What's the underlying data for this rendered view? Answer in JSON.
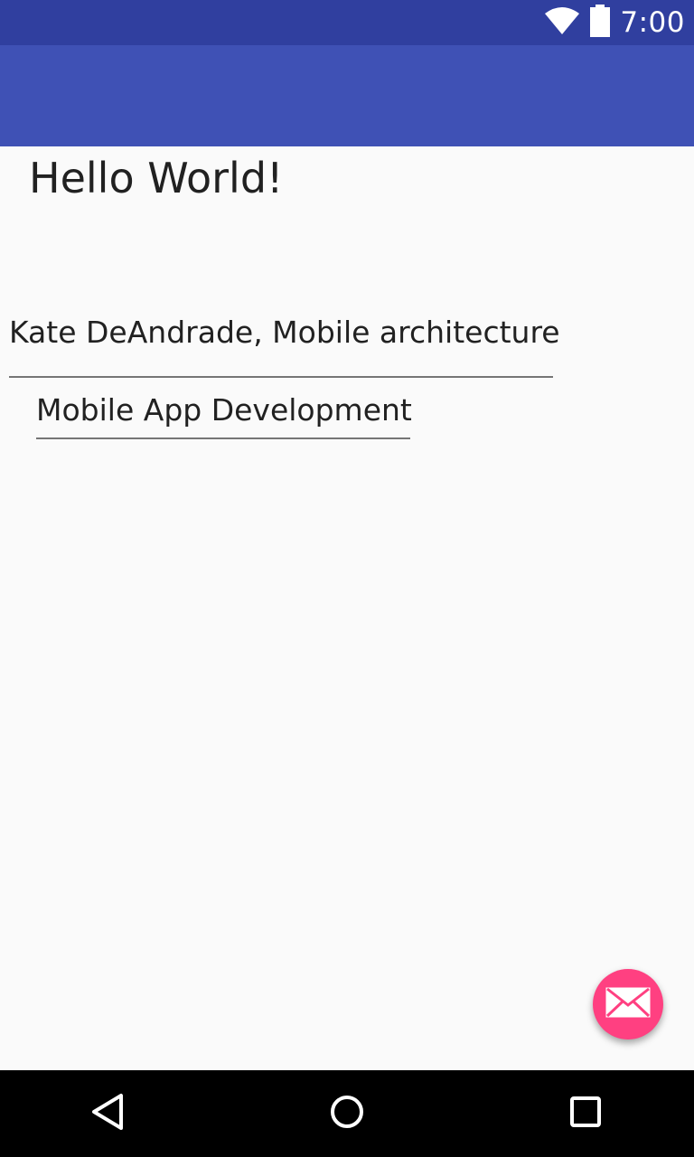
{
  "status_bar": {
    "time": "7:00",
    "icons": [
      "wifi-icon",
      "battery-icon"
    ]
  },
  "main": {
    "hello_text": "Hello World!",
    "name_field_value": "Kate DeAndrade, Mobile architecture",
    "course_field_value": "Mobile App Development"
  },
  "fab": {
    "icon": "email-icon",
    "color": "#ff4081"
  },
  "nav_bar": {
    "icons": [
      "back-icon",
      "home-icon",
      "recents-icon"
    ]
  },
  "colors": {
    "status_bar": "#303f9f",
    "app_bar": "#3f51b5",
    "background": "#fafafa",
    "accent": "#ff4081"
  }
}
